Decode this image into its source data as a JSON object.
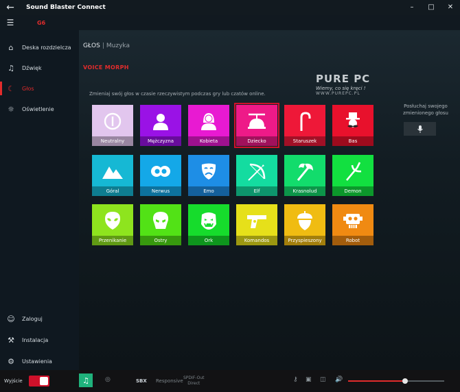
{
  "window": {
    "title": "Sound Blaster Connect"
  },
  "device": {
    "name": "G6"
  },
  "sidebar": {
    "items": [
      {
        "label": "Deska rozdzielcza",
        "icon": "home-icon"
      },
      {
        "label": "Dźwięk",
        "icon": "music-note-icon"
      },
      {
        "label": "Głos",
        "icon": "mouth-icon",
        "active": true
      },
      {
        "label": "Oświetlenie",
        "icon": "light-bulb-icon"
      }
    ],
    "bottom_items": [
      {
        "label": "Zaloguj",
        "icon": "person-icon"
      },
      {
        "label": "Instalacja",
        "icon": "wrench-icon"
      },
      {
        "label": "Ustawienia",
        "icon": "gear-icon"
      }
    ]
  },
  "main": {
    "breadcrumb": {
      "section": "GŁOS",
      "separator": "|",
      "subsection": "Muzyka"
    },
    "section_title": "VOICE MORPH",
    "instructions": "Zmieniaj swój głos w czasie rzeczywistym podczas gry lub czatów online.",
    "watermark": {
      "logo": "PURE PC",
      "tagline": "Wiemy, co się kręci !",
      "url": "WWW.PUREPC.PL"
    },
    "preview": {
      "label": "Posłuchaj swojego zmienionego głosu"
    },
    "selected_tile": "Dziecko",
    "tiles": [
      {
        "label": "Neutralny",
        "color": "#e2c6ee",
        "icon": "neutral-icon"
      },
      {
        "label": "Mężczyzna",
        "color": "#9a12e6",
        "icon": "man-icon"
      },
      {
        "label": "Kobieta",
        "color": "#e81ad2",
        "icon": "woman-icon"
      },
      {
        "label": "Dziecko",
        "color": "#ee1a88",
        "icon": "propeller-hat-icon"
      },
      {
        "label": "Staruszek",
        "color": "#ee1838",
        "icon": "cane-icon"
      },
      {
        "label": "Bas",
        "color": "#e8112c",
        "icon": "gentleman-icon"
      },
      {
        "label": "Góral",
        "color": "#16b8d4",
        "icon": "mountain-icon"
      },
      {
        "label": "Nerwus",
        "color": "#14a8e8",
        "icon": "eyes-icon"
      },
      {
        "label": "Emo",
        "color": "#1e8ee6",
        "icon": "theater-mask-icon"
      },
      {
        "label": "Elf",
        "color": "#14dca0",
        "icon": "bow-icon"
      },
      {
        "label": "Krasnolud",
        "color": "#12dc6c",
        "icon": "axe-icon"
      },
      {
        "label": "Demon",
        "color": "#12e040",
        "icon": "trident-icon"
      },
      {
        "label": "Przenikanie",
        "color": "#8ee41e",
        "icon": "alien-icon"
      },
      {
        "label": "Ostry",
        "color": "#52e216",
        "icon": "skull-icon"
      },
      {
        "label": "Ork",
        "color": "#16dc2c",
        "icon": "orc-icon"
      },
      {
        "label": "Komandos",
        "color": "#e6e01a",
        "icon": "pistol-icon"
      },
      {
        "label": "Przyspieszony",
        "color": "#f0bc12",
        "icon": "acorn-icon"
      },
      {
        "label": "Robot",
        "color": "#f08a12",
        "icon": "robot-icon"
      }
    ]
  },
  "bottom": {
    "exit_label": "Wyjście",
    "sbx": "SBX",
    "response_label": "Responsive",
    "spdif": {
      "line1": "SPDIF-Out",
      "line2": "Direct"
    },
    "volume": 0.59
  },
  "colors": {
    "accent": "#e22c2c",
    "music": "#1fb27c"
  }
}
